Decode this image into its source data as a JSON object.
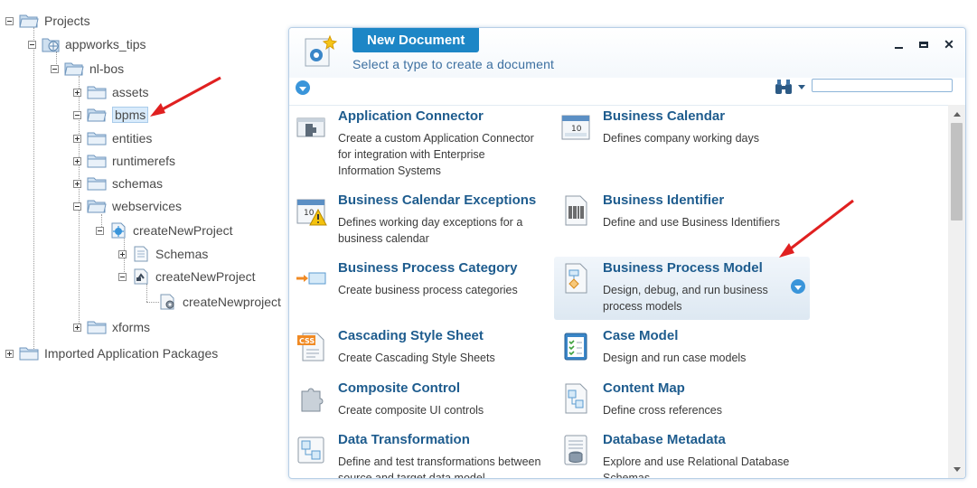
{
  "tree": {
    "projects": "Projects",
    "appworks_tips": "appworks_tips",
    "nl_bos": "nl-bos",
    "assets": "assets",
    "bpms": "bpms",
    "entities": "entities",
    "runtimerefs": "runtimerefs",
    "schemas": "schemas",
    "webservices": "webservices",
    "createNewProject": "createNewProject",
    "schemas_node": "Schemas",
    "createNewProject2": "createNewProject",
    "createNewproject_leaf": "createNewproject",
    "xforms": "xforms",
    "imported": "Imported Application Packages"
  },
  "dialog": {
    "title": "New Document",
    "subtitle": "Select a type to create a document",
    "search_placeholder": "",
    "items": [
      {
        "name": "Application Connector",
        "desc": "Create a custom Application Connector for integration with Enterprise Information Systems"
      },
      {
        "name": "Business Calendar",
        "desc": "Defines company working days"
      },
      {
        "name": "Business Calendar Exceptions",
        "desc": "Defines working day exceptions for a business calendar"
      },
      {
        "name": "Business Identifier",
        "desc": "Define and use Business Identifiers"
      },
      {
        "name": "Business Process Category",
        "desc": "Create business process categories"
      },
      {
        "name": "Business Process Model",
        "desc": "Design, debug, and run business process models"
      },
      {
        "name": "Cascading Style Sheet",
        "desc": "Create Cascading Style Sheets"
      },
      {
        "name": "Case Model",
        "desc": "Design and run case models"
      },
      {
        "name": "Composite Control",
        "desc": "Create composite UI controls"
      },
      {
        "name": "Content Map",
        "desc": "Define cross references"
      },
      {
        "name": "Data Transformation",
        "desc": "Define and test transformations between source and target data model"
      },
      {
        "name": "Database Metadata",
        "desc": "Explore and use Relational Database Schemas"
      }
    ]
  },
  "icons": {
    "calendar_day": "10",
    "css_label": "CSS"
  },
  "colors": {
    "accent": "#1d86c6",
    "link": "#1e5c8e",
    "annotation_arrow": "#e02020"
  }
}
